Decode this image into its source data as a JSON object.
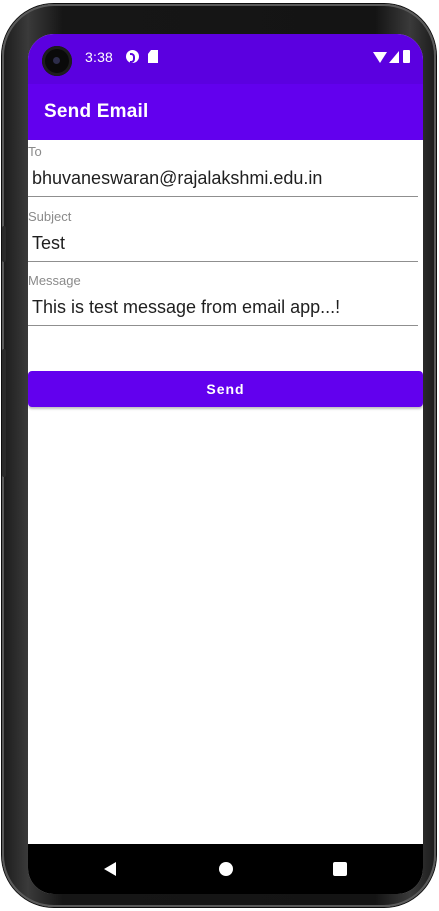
{
  "status_bar": {
    "time": "3:38",
    "icons": [
      "camera-cutout-icon",
      "sync-icon",
      "sd-card-icon",
      "wifi-icon",
      "signal-icon",
      "battery-icon"
    ]
  },
  "app_bar": {
    "title": "Send Email"
  },
  "form": {
    "to": {
      "label": "To",
      "value": "bhuvaneswaran@rajalakshmi.edu.in"
    },
    "subject": {
      "label": "Subject",
      "value": "Test"
    },
    "message": {
      "label": "Message",
      "value": "This is test message from email app...!"
    },
    "send_label": "Send"
  },
  "nav_bar": {
    "icons": [
      "back-icon",
      "home-icon",
      "recents-icon"
    ]
  },
  "colors": {
    "primary": "#6200ee",
    "status_bar": "#5b00e0",
    "nav_bar": "#000000"
  }
}
